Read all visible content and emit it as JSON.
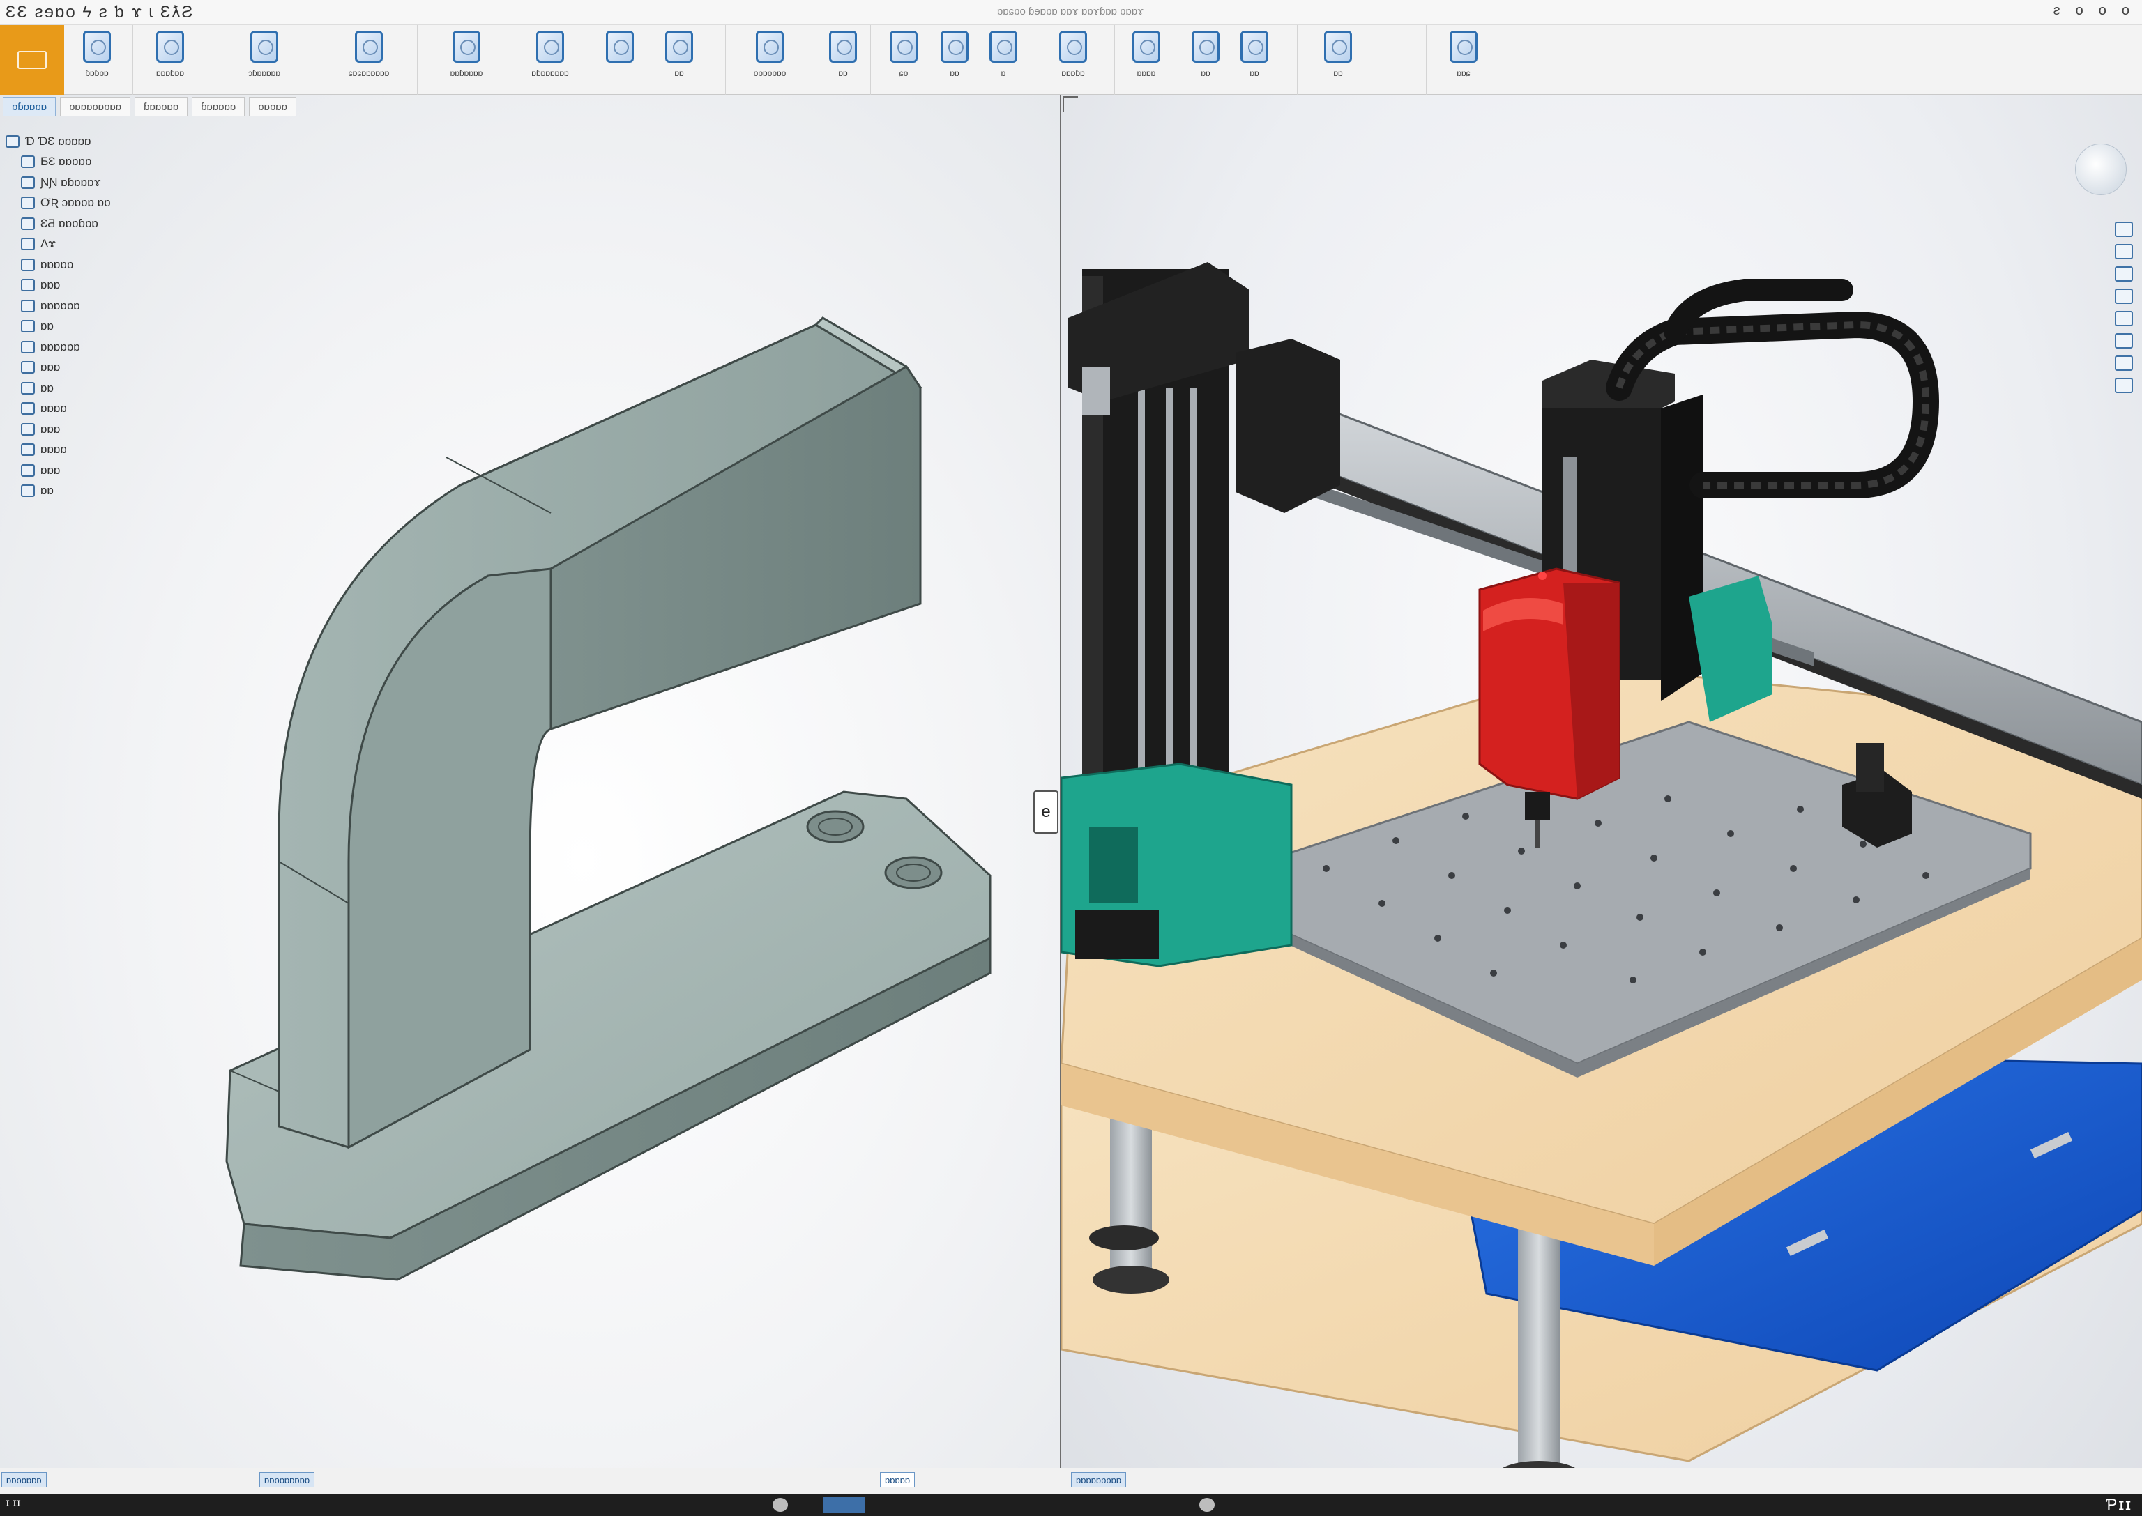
{
  "titlebar": {
    "left_text": "ƐƐ ƨɘɒo  ϟ ƨ ƅ ɤ ɩ ƐƛƧ",
    "center_text": "ɒɒɕɒo ɓɘɒɒɒ ɒɒɤ ɒɒɤɓɒɒ ɒɒɒɤ",
    "window_buttons": [
      "ƨ",
      "o",
      "o",
      "o"
    ]
  },
  "ribbon": {
    "buttons": [
      {
        "label": "ɓɒɓɒɒ",
        "icon": "grid-icon"
      },
      {
        "label": "ɒɒɒɓɒɒ",
        "icon": "circle-icon"
      },
      {
        "label": "ɔɓɒɒɒɒɒ",
        "icon": "tool-icon"
      },
      {
        "label": "ɕɒɕɒɒɒɒɒɒ",
        "icon": "bracket-icon"
      },
      {
        "label": "ɒɒɓɒɒɒɒ",
        "icon": "extrude-icon"
      },
      {
        "label": "ɒɓɒɒɒɒɒɒ",
        "icon": "revolve-icon"
      },
      {
        "label": "",
        "icon": "sweep-icon"
      },
      {
        "label": "ɒɒ",
        "icon": "fillet-icon"
      },
      {
        "label": "ɒɒɒɒɒɒɒ",
        "icon": "chamfer-icon"
      },
      {
        "label": "ɒɒ",
        "icon": "shell-icon"
      },
      {
        "label": "ɕɒ",
        "icon": "pattern-icon"
      },
      {
        "label": "ɒɒ",
        "icon": "mirror-icon"
      },
      {
        "label": "ɒ",
        "icon": "rib-icon"
      },
      {
        "label": "ɒɒɒɓɒ",
        "icon": "draft-icon"
      },
      {
        "label": "ɒɒɒɒ",
        "icon": "measure-icon"
      },
      {
        "label": "ɒɒ",
        "icon": "section-icon"
      },
      {
        "label": "ɒɒ",
        "icon": "view-icon"
      },
      {
        "label": "ɒɒ",
        "icon": "render-icon"
      },
      {
        "label": "ɒɒɕ",
        "icon": "settings-icon"
      }
    ]
  },
  "tabs": [
    "ɒɓɒɒɒɒ",
    "ɒɒɒɒɒɒɒɒɒ",
    "ɓɒɒɒɒɒ",
    "ɓɒɒɒɒɒ",
    "ɒɒɒɒɒ"
  ],
  "tree": [
    {
      "label": "Ɗ  ƊƐ ɒɒɒɒɒ",
      "level": 0
    },
    {
      "label": "ƂƐ ɒɒɒɒɒ",
      "level": 1
    },
    {
      "label": "ƝƝ ɒɓɒɒɒɤ",
      "level": 1
    },
    {
      "label": "ƠƦ ɔɒɒɒɒ ɒɒ",
      "level": 1
    },
    {
      "label": "ƐƋ ɒɒɒɓɒɒ",
      "level": 1
    },
    {
      "label": "Ʌɤ",
      "level": 1
    },
    {
      "label": "ɒɒɒɒɒ",
      "level": 1
    },
    {
      "label": "ɒɒɒ",
      "level": 1
    },
    {
      "label": "ɒɒɒɒɒɒ",
      "level": 1
    },
    {
      "label": "ɒɒ",
      "level": 1
    },
    {
      "label": "ɒɒɒɒɒɒ",
      "level": 1
    },
    {
      "label": "ɒɒɒ",
      "level": 1
    },
    {
      "label": "ɒɒ",
      "level": 1
    },
    {
      "label": "ɒɒɒɒ",
      "level": 1
    },
    {
      "label": "ɒɒɒ",
      "level": 1
    },
    {
      "label": "ɒɒɒɒ",
      "level": 1
    },
    {
      "label": "ɒɒɒ",
      "level": 1
    },
    {
      "label": "ɒɒ",
      "level": 1
    }
  ],
  "viewport": {
    "split_handle": "e",
    "left_model": "bracket-part",
    "right_model": "cnc-gantry-assembly"
  },
  "statusbar": {
    "chip1": "ɒɒɒɒɒɒɒ",
    "chip2": "ɒɒɒɒɒɒɒɒɒ",
    "mid1": "ɒɒɒɒɒ",
    "mid2": "ɒɒɒɒɒɒɒɒɒ"
  },
  "taskbar": {
    "left": "ɪ ɪɪ",
    "right": "Ƥɪɪ"
  },
  "colors": {
    "app_button": "#e89a19",
    "accent": "#2f6fb0",
    "part_fill": "#8fa3a0",
    "spindle_red": "#d21f1f",
    "teal": "#1fa38b",
    "wood": "#f1d6ad",
    "bin_blue": "#1556c9",
    "plate_gray": "#9aa0a6"
  }
}
